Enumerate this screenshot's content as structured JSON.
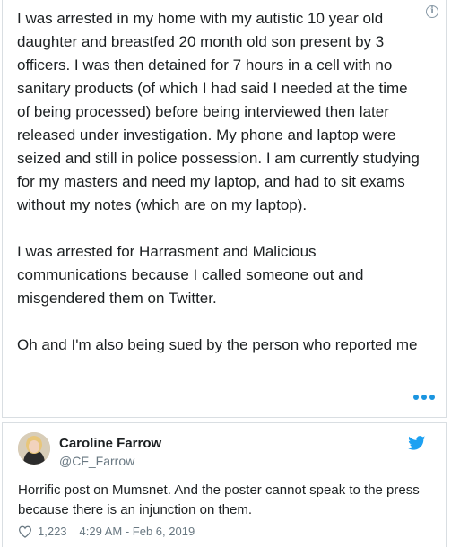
{
  "post": {
    "paragraphs": [
      "I was arrested in my home with my autistic 10 year old daughter and breastfed 20 month old son present by 3 officers. I was then detained for 7 hours in a cell with no sanitary products (of which I had said I needed at the time of being processed) before being interviewed then later released under investigation. My phone and laptop were seized and still in police possession. I am currently studying for my masters and need my laptop, and had to sit exams without my notes (which are on my laptop).",
      "I was arrested for Harrasment and Malicious communications because I called someone out and misgendered them on Twitter.",
      "Oh and I'm also being sued by the person who reported me"
    ],
    "info_icon": "info-icon",
    "more_icon": "more-dots-icon"
  },
  "tweet": {
    "author_name": "Caroline Farrow",
    "author_handle": "@CF_Farrow",
    "text": "Horrific post on Mumsnet. And the poster cannot speak to the press because there is an injunction on them.",
    "likes": "1,223",
    "timestamp": "4:29 AM - Feb 6, 2019",
    "brand_icon": "twitter-bird-icon",
    "like_icon": "heart-icon",
    "colors": {
      "twitter_blue": "#1da1f2",
      "dots_blue": "#1b95e0",
      "meta_gray": "#697882"
    }
  }
}
